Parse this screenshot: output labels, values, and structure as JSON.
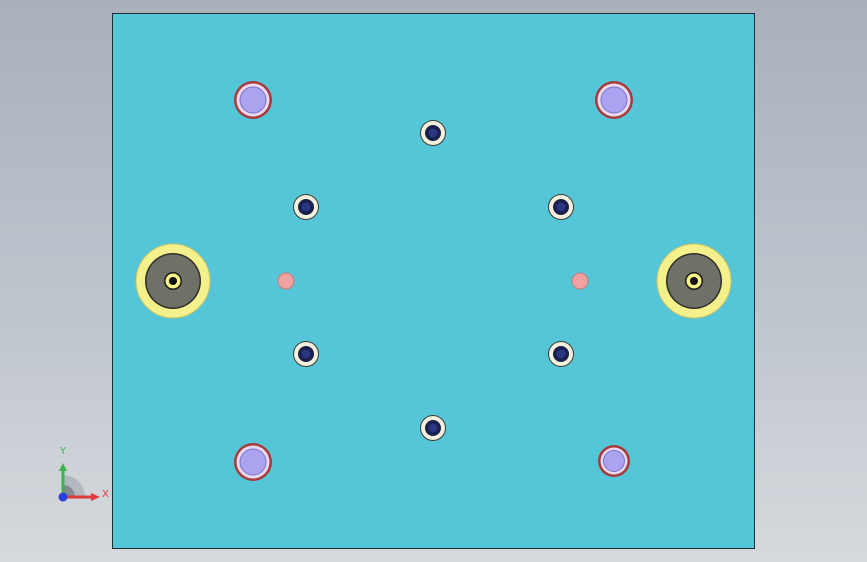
{
  "viewport": {
    "background_top": "#a9b0bb",
    "background_bottom": "#d6dade"
  },
  "plate": {
    "fill": "#55c5d8",
    "edge": "#1e2e34"
  },
  "colors": {
    "guide_pin_outer": "#a83a3a",
    "guide_pin_ring": "#e8d9f0",
    "guide_pin_fill": "#a9a3f0",
    "screw_washer": "#f4f0dc",
    "screw_core": "#19204e",
    "bushing_outer": "#f4f08c",
    "bushing_mid": "#6f7168",
    "bushing_core": "#f8f488",
    "pin_hole": "#f1a2a0",
    "axis_x": "#e23a3a",
    "axis_y": "#39b54a",
    "axis_z": "#2640d8"
  },
  "triad": {
    "x_label": "X",
    "y_label": "Y",
    "icon": "coordinate-triad-icon"
  }
}
